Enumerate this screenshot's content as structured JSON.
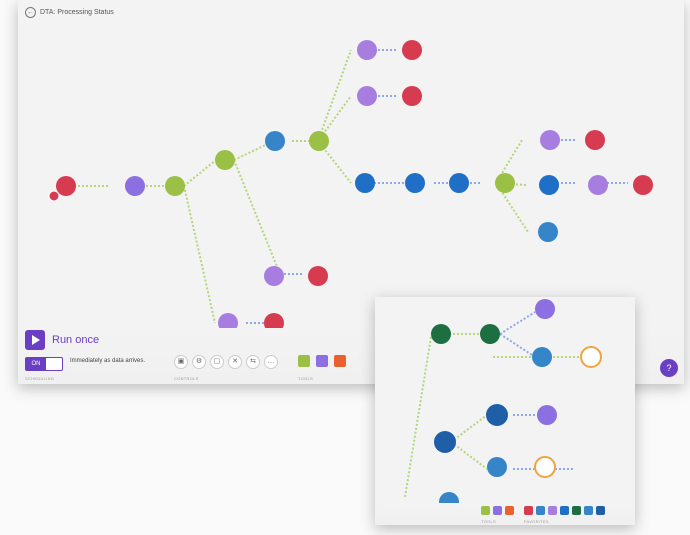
{
  "main_window": {
    "title": "DTA: Processing Status",
    "run_once_label": "Run once",
    "toggle_label": "ON",
    "schedule_text": "Immediately as data arrives.",
    "scheduling_label": "SCHEDULING",
    "controls_label": "CONTROLS",
    "tools_label": "TOOLS"
  },
  "second_window": {
    "tools_label": "TOOLS",
    "favorites_label": "FAVORITES"
  },
  "colors": {
    "accent": "#6b3fc4",
    "webhook": "#d63b50",
    "router": "#9ac045",
    "json": "#a77ee0",
    "onedrive": "#1f6fc6",
    "datastore": "#3585c8",
    "tools": "#8c6fe0",
    "excel": "#1d6f42",
    "csv": "#1f5fa8",
    "sleep": "#f2a341"
  }
}
